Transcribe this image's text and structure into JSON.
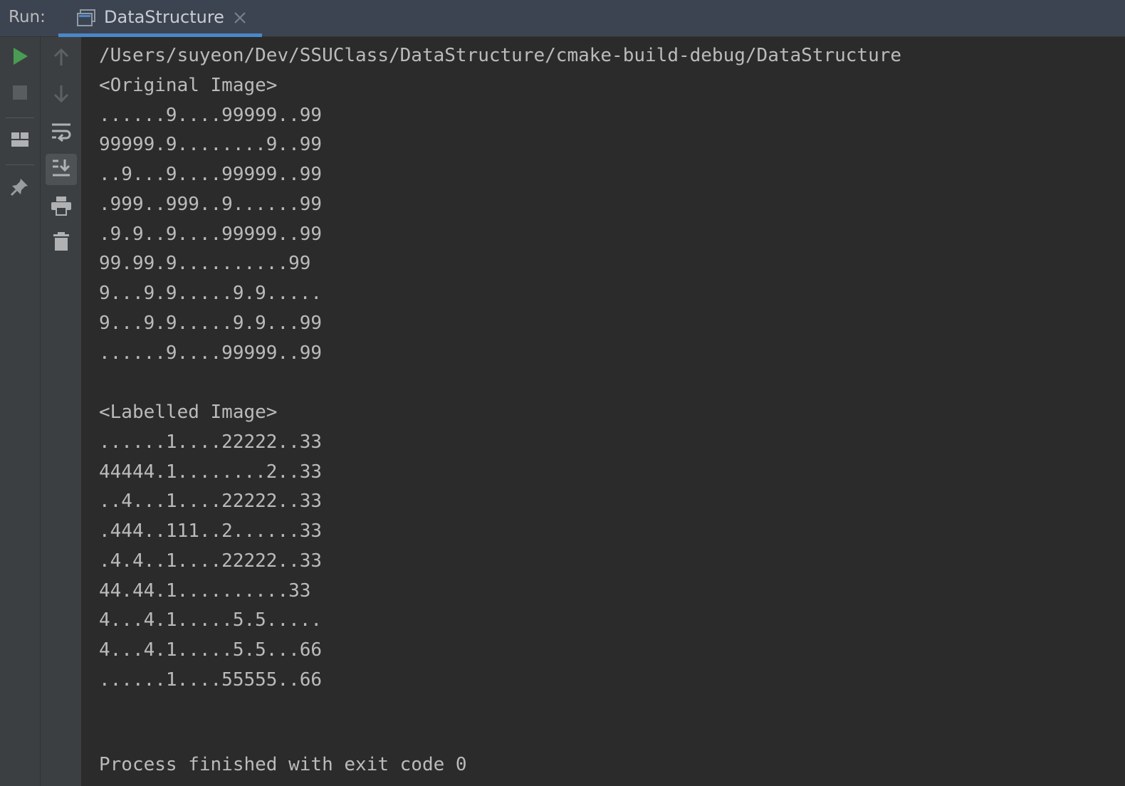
{
  "run_panel": {
    "label": "Run:",
    "tab": {
      "title": "DataStructure",
      "icon": "console-window-icon",
      "close_icon": "close-icon"
    },
    "accent_color": "#4a88c7"
  },
  "toolbar_left": {
    "items": [
      {
        "icon": "run-icon",
        "color": "#499c54"
      },
      {
        "icon": "stop-icon"
      },
      {
        "icon": "layout-icon"
      },
      {
        "icon": "pin-icon"
      }
    ]
  },
  "toolbar_right": {
    "items": [
      {
        "icon": "arrow-up-icon"
      },
      {
        "icon": "arrow-down-icon"
      },
      {
        "icon": "soft-wrap-icon"
      },
      {
        "icon": "scroll-to-end-icon",
        "active": true
      },
      {
        "icon": "print-icon"
      },
      {
        "icon": "trash-icon"
      }
    ]
  },
  "console": {
    "path": "/Users/suyeon/Dev/SSUClass/DataStructure/cmake-build-debug/DataStructure",
    "original_header": "<Original Image>",
    "original_rows": [
      "......9....99999..99",
      "99999.9........9..99",
      "..9...9....99999..99",
      ".999..999..9......99",
      ".9.9..9....99999..99",
      "99.99.9..........99",
      "9...9.9.....9.9.....",
      "9...9.9.....9.9...99",
      "......9....99999..99"
    ],
    "labelled_header": "<Labelled Image>",
    "labelled_rows": [
      "......1....22222..33",
      "44444.1........2..33",
      "..4...1....22222..33",
      ".444..111..2......33",
      ".4.4..1....22222..33",
      "44.44.1..........33",
      "4...4.1.....5.5.....",
      "4...4.1.....5.5...66",
      "......1....55555..66"
    ],
    "exit_message": "Process finished with exit code 0"
  }
}
